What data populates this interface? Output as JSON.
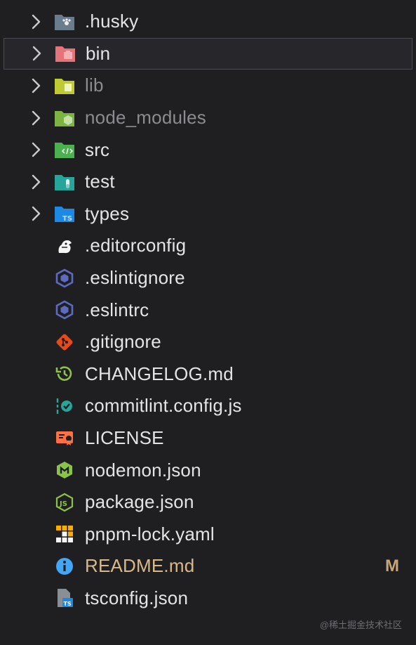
{
  "explorer": {
    "folders": [
      {
        "label": ".husky",
        "icon": "husky-folder-icon",
        "dim": false
      },
      {
        "label": "bin",
        "icon": "bin-folder-icon",
        "dim": false,
        "selected": true
      },
      {
        "label": "lib",
        "icon": "lib-folder-icon",
        "dim": true
      },
      {
        "label": "node_modules",
        "icon": "node-modules-folder-icon",
        "dim": true
      },
      {
        "label": "src",
        "icon": "src-folder-icon",
        "dim": false
      },
      {
        "label": "test",
        "icon": "test-folder-icon",
        "dim": false
      },
      {
        "label": "types",
        "icon": "types-folder-icon",
        "dim": false
      }
    ],
    "files": [
      {
        "label": ".editorconfig",
        "icon": "editorconfig-icon"
      },
      {
        "label": ".eslintignore",
        "icon": "eslint-icon"
      },
      {
        "label": ".eslintrc",
        "icon": "eslint-icon"
      },
      {
        "label": ".gitignore",
        "icon": "git-icon"
      },
      {
        "label": "CHANGELOG.md",
        "icon": "changelog-icon"
      },
      {
        "label": "commitlint.config.js",
        "icon": "commitlint-icon"
      },
      {
        "label": "LICENSE",
        "icon": "license-icon"
      },
      {
        "label": "nodemon.json",
        "icon": "nodemon-icon"
      },
      {
        "label": "package.json",
        "icon": "nodejs-icon"
      },
      {
        "label": "pnpm-lock.yaml",
        "icon": "pnpm-icon"
      },
      {
        "label": "README.md",
        "icon": "info-icon",
        "status": "M"
      },
      {
        "label": "tsconfig.json",
        "icon": "tsconfig-icon"
      }
    ]
  },
  "watermark": "@稀土掘金技术社区",
  "colors": {
    "background": "#1f1f21",
    "modified": "#d9b98a",
    "selected_border": "#4a4a50"
  }
}
